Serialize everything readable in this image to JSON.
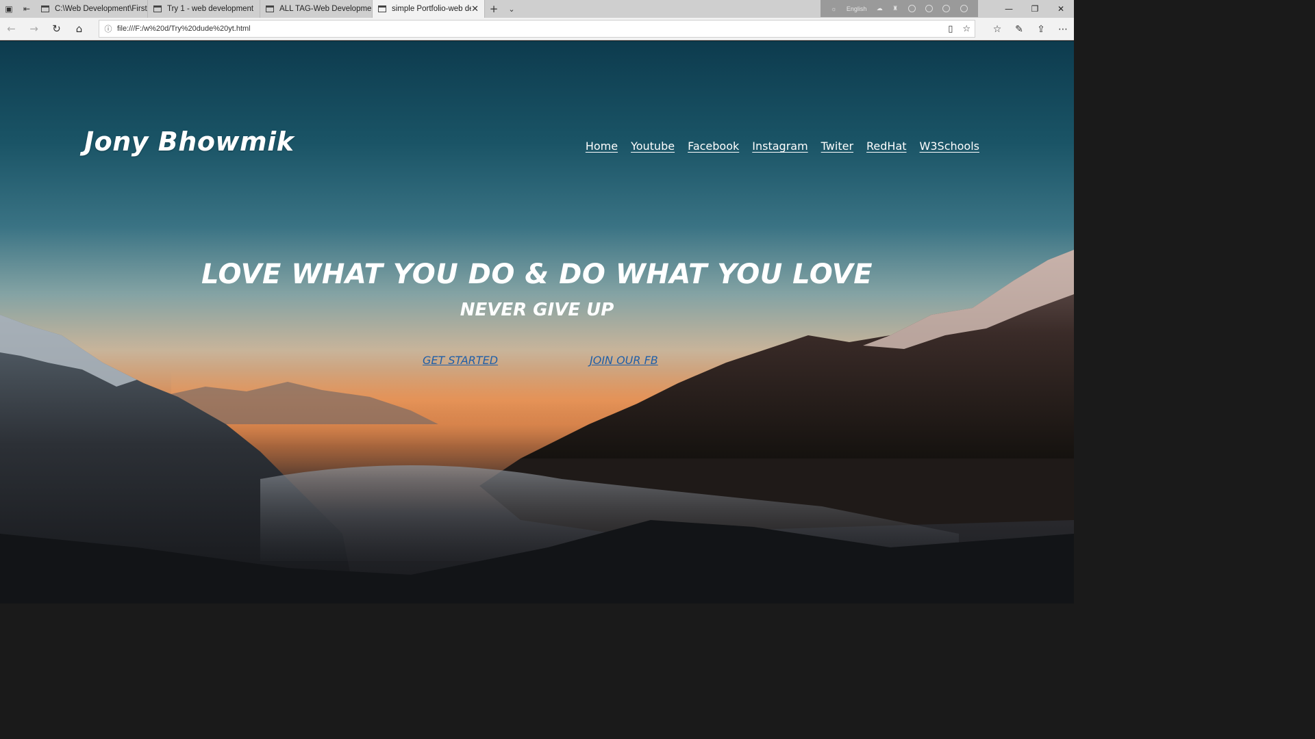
{
  "browser": {
    "tabs": [
      {
        "label": "C:\\Web Development\\First \\",
        "active": false
      },
      {
        "label": "Try 1 - web development",
        "active": false
      },
      {
        "label": "ALL TAG-Web Development",
        "active": false
      },
      {
        "label": "simple Portfolio-web de",
        "active": true
      }
    ],
    "tray_language": "English",
    "url": "file:///F:/w%20d/Try%20dude%20yt.html"
  },
  "page": {
    "logo": "Jony Bhowmik",
    "nav": [
      "Home",
      "Youtube",
      "Facebook",
      "Instagram",
      "Twiter",
      "RedHat",
      "W3Schools"
    ],
    "headline": "LOVE WHAT YOU DO & DO WHAT YOU LOVE",
    "subheadline": "NEVER GIVE UP",
    "buttons": {
      "get_started": "GET STARTED",
      "join_fb": "JOIN OUR FB"
    },
    "colors": {
      "text": "#ffffff",
      "link": "#1f5fa8",
      "sky_top": "#0d3b4e",
      "sunset": "#d98a52"
    }
  }
}
